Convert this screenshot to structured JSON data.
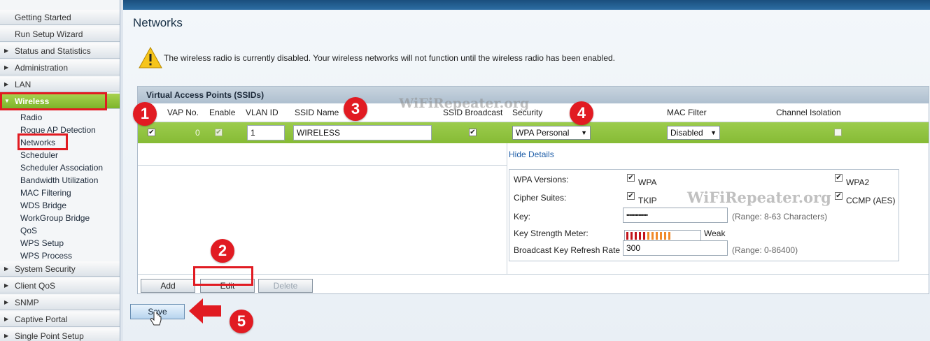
{
  "sidebar": {
    "items": [
      {
        "label": "Getting Started"
      },
      {
        "label": "Run Setup Wizard"
      },
      {
        "label": "Status and Statistics"
      },
      {
        "label": "Administration"
      },
      {
        "label": "LAN"
      },
      {
        "label": "Wireless"
      },
      {
        "label": "System Security"
      },
      {
        "label": "Client QoS"
      },
      {
        "label": "SNMP"
      },
      {
        "label": "Captive Portal"
      },
      {
        "label": "Single Point Setup"
      }
    ],
    "wireless_sub": [
      "Radio",
      "Rogue AP Detection",
      "Networks",
      "Scheduler",
      "Scheduler Association",
      "Bandwidth Utilization",
      "MAC Filtering",
      "WDS Bridge",
      "WorkGroup Bridge",
      "QoS",
      "WPS Setup",
      "WPS Process"
    ]
  },
  "page": {
    "title": "Networks",
    "warning": "The wireless radio is currently disabled. Your wireless networks will not function until the wireless radio has been enabled."
  },
  "vap": {
    "section_title": "Virtual Access Points (SSIDs)",
    "columns": [
      "VAP No.",
      "Enable",
      "VLAN ID",
      "SSID Name",
      "SSID Broadcast",
      "Security",
      "MAC Filter",
      "Channel Isolation"
    ],
    "row": {
      "vap_no": "0",
      "vlan_id": "1",
      "ssid_name": "WIRELESS",
      "security": "WPA Personal",
      "mac_filter": "Disabled"
    },
    "hide_details": "Hide Details",
    "details": {
      "wpa_versions_label": "WPA Versions:",
      "wpa": "WPA",
      "wpa2": "WPA2",
      "cipher_label": "Cipher Suites:",
      "tkip": "TKIP",
      "ccmp": "CCMP (AES)",
      "key_label": "Key:",
      "key_value": "••••••••••••••",
      "key_range": "(Range: 8-63 Characters)",
      "strength_label": "Key Strength Meter:",
      "strength_text": "Weak",
      "strength_level": 0.6,
      "refresh_label": "Broadcast Key Refresh Rate",
      "refresh_value": "300",
      "refresh_range": "(Range: 0-86400)"
    },
    "buttons": {
      "add": "Add",
      "edit": "Edit",
      "delete": "Delete"
    }
  },
  "save_label": "Save",
  "annotations": [
    "1",
    "2",
    "3",
    "4",
    "5"
  ],
  "watermarks": [
    "WiFiRepeater.org",
    "WiFiRepeater.org"
  ],
  "colors": {
    "active_green": "#8dc13c",
    "annotation_red": "#e11b22",
    "link_blue": "#1f5ea8"
  }
}
